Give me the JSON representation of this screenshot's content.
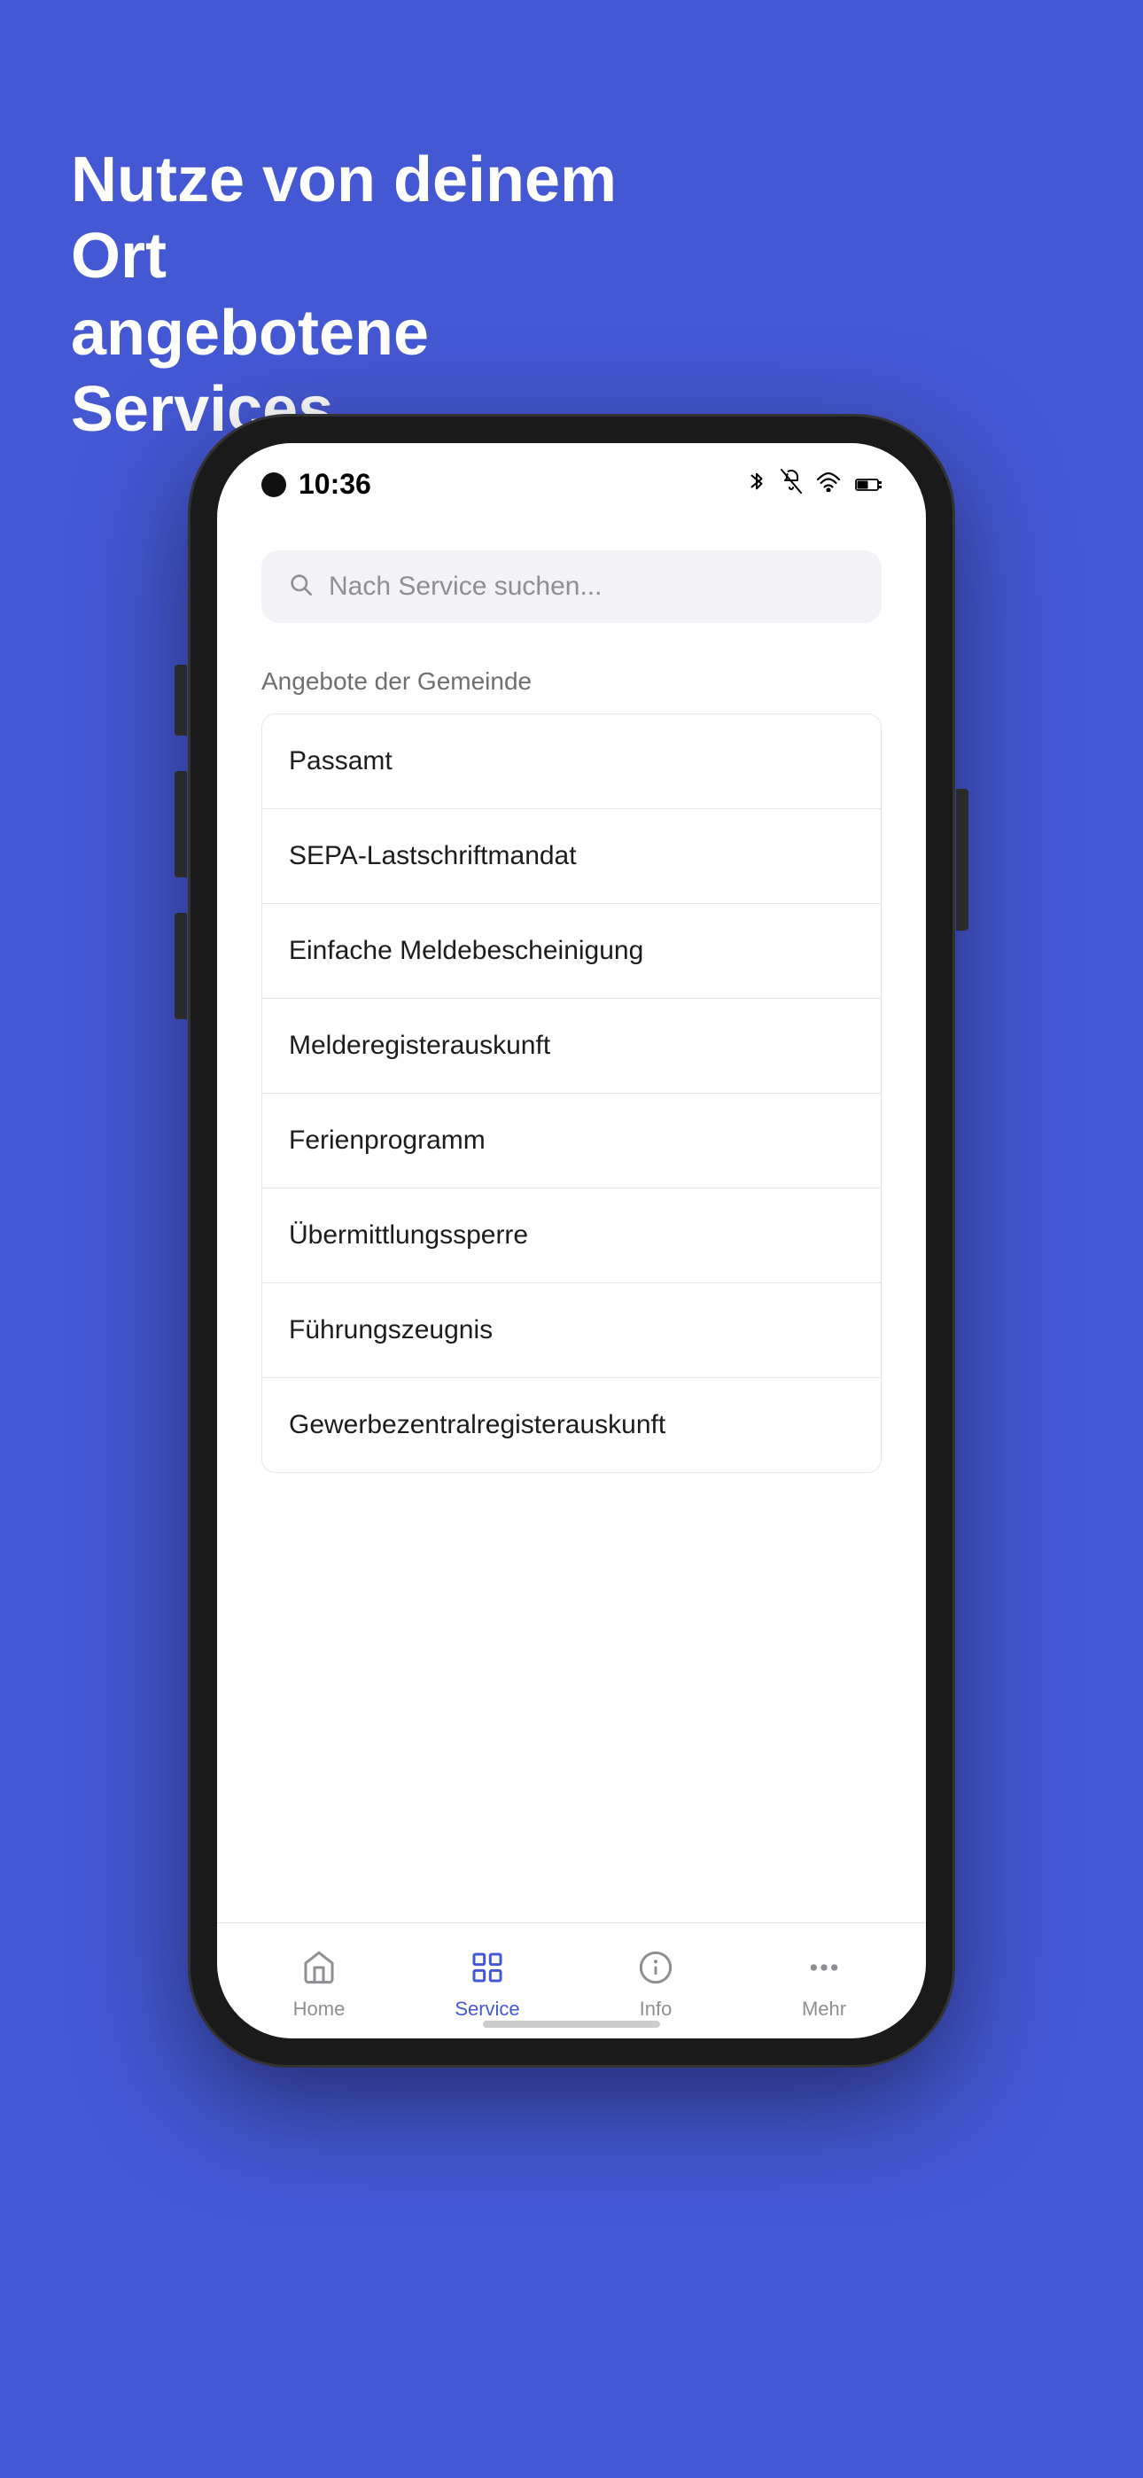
{
  "background_color": "#4558d4",
  "headline": {
    "line1": "Nutze von deinem Ort",
    "line2": "angebotene Services"
  },
  "phone": {
    "status_bar": {
      "time": "10:36",
      "icons": [
        "bluetooth",
        "bell-off",
        "wifi",
        "battery"
      ]
    },
    "search": {
      "placeholder": "Nach Service suchen..."
    },
    "section_label": "Angebote der Gemeinde",
    "service_items": [
      "Passamt",
      "SEPA-Lastschriftmandat",
      "Einfache Meldebescheinigung",
      "Melderegisterauskunft",
      "Ferienprogramm",
      "Übermittlungssperre",
      "Führungszeugnis",
      "Gewerbezentralregisterauskunft"
    ],
    "bottom_nav": [
      {
        "id": "home",
        "label": "Home",
        "active": false
      },
      {
        "id": "service",
        "label": "Service",
        "active": true
      },
      {
        "id": "info",
        "label": "Info",
        "active": false
      },
      {
        "id": "mehr",
        "label": "Mehr",
        "active": false
      }
    ]
  }
}
